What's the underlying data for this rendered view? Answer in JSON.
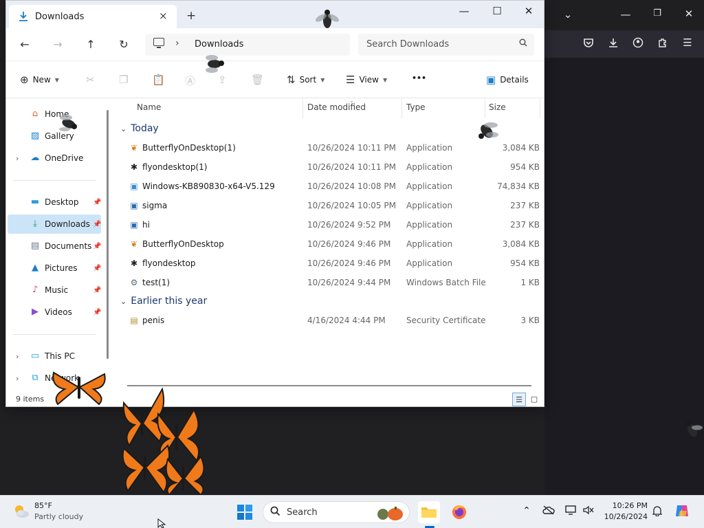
{
  "window": {
    "tab_title": "Downloads",
    "tab_close": "×",
    "new_tab": "+",
    "controls": {
      "minimize": "—",
      "maximize": "☐",
      "close": "✕"
    }
  },
  "address": {
    "path": "Downloads",
    "search_placeholder": "Search Downloads"
  },
  "commands": {
    "new": "New",
    "sort": "Sort",
    "view": "View",
    "more": "•••",
    "details": "Details"
  },
  "sidebar": {
    "top": [
      {
        "label": "Home",
        "icon": "home-icon"
      },
      {
        "label": "Gallery",
        "icon": "gallery-icon"
      },
      {
        "label": "OneDrive",
        "icon": "onedrive-icon"
      }
    ],
    "quick": [
      {
        "label": "Desktop",
        "icon": "desktop-icon"
      },
      {
        "label": "Downloads",
        "icon": "download-icon"
      },
      {
        "label": "Documents",
        "icon": "documents-icon"
      },
      {
        "label": "Pictures",
        "icon": "pictures-icon"
      },
      {
        "label": "Music",
        "icon": "music-icon"
      },
      {
        "label": "Videos",
        "icon": "videos-icon"
      }
    ],
    "bottom": [
      {
        "label": "This PC",
        "icon": "this-pc-icon"
      },
      {
        "label": "Network",
        "icon": "network-icon"
      }
    ]
  },
  "columns": {
    "name": "Name",
    "date": "Date modified",
    "type": "Type",
    "size": "Size"
  },
  "groups": [
    {
      "label": "Today",
      "files": [
        {
          "name": "ButterflyOnDesktop(1)",
          "date": "10/26/2024 10:11 PM",
          "type": "Application",
          "size": "3,084 KB",
          "icon": "butterfly-app-icon"
        },
        {
          "name": "flyondesktop(1)",
          "date": "10/26/2024 10:11 PM",
          "type": "Application",
          "size": "954 KB",
          "icon": "fly-app-icon"
        },
        {
          "name": "Windows-KB890830-x64-V5.129",
          "date": "10/26/2024 10:08 PM",
          "type": "Application",
          "size": "74,834 KB",
          "icon": "installer-app-icon"
        },
        {
          "name": "sigma",
          "date": "10/26/2024 10:05 PM",
          "type": "Application",
          "size": "237 KB",
          "icon": "window-app-icon"
        },
        {
          "name": "hi",
          "date": "10/26/2024 9:52 PM",
          "type": "Application",
          "size": "237 KB",
          "icon": "window-app-icon"
        },
        {
          "name": "ButterflyOnDesktop",
          "date": "10/26/2024 9:46 PM",
          "type": "Application",
          "size": "3,084 KB",
          "icon": "butterfly-app-icon"
        },
        {
          "name": "flyondesktop",
          "date": "10/26/2024 9:46 PM",
          "type": "Application",
          "size": "954 KB",
          "icon": "fly-app-icon"
        },
        {
          "name": "test(1)",
          "date": "10/26/2024 9:44 PM",
          "type": "Windows Batch File",
          "size": "1 KB",
          "icon": "batch-file-icon"
        }
      ]
    },
    {
      "label": "Earlier this year",
      "files": [
        {
          "name": "penis",
          "date": "4/16/2024 4:44 PM",
          "type": "Security Certificate",
          "size": "3 KB",
          "icon": "certificate-icon"
        }
      ]
    }
  ],
  "status": {
    "count": "9 items"
  },
  "taskbar": {
    "temperature": "85°F",
    "condition": "Partly cloudy",
    "search_label": "Search",
    "time": "10:26 PM",
    "date": "10/26/2024"
  },
  "colors": {
    "accent": "#0067c0",
    "selected_bg": "#cce4f7",
    "group_header": "#1a3a6b",
    "desktop_bg": "#202023",
    "butterfly": "#f07a1a"
  }
}
